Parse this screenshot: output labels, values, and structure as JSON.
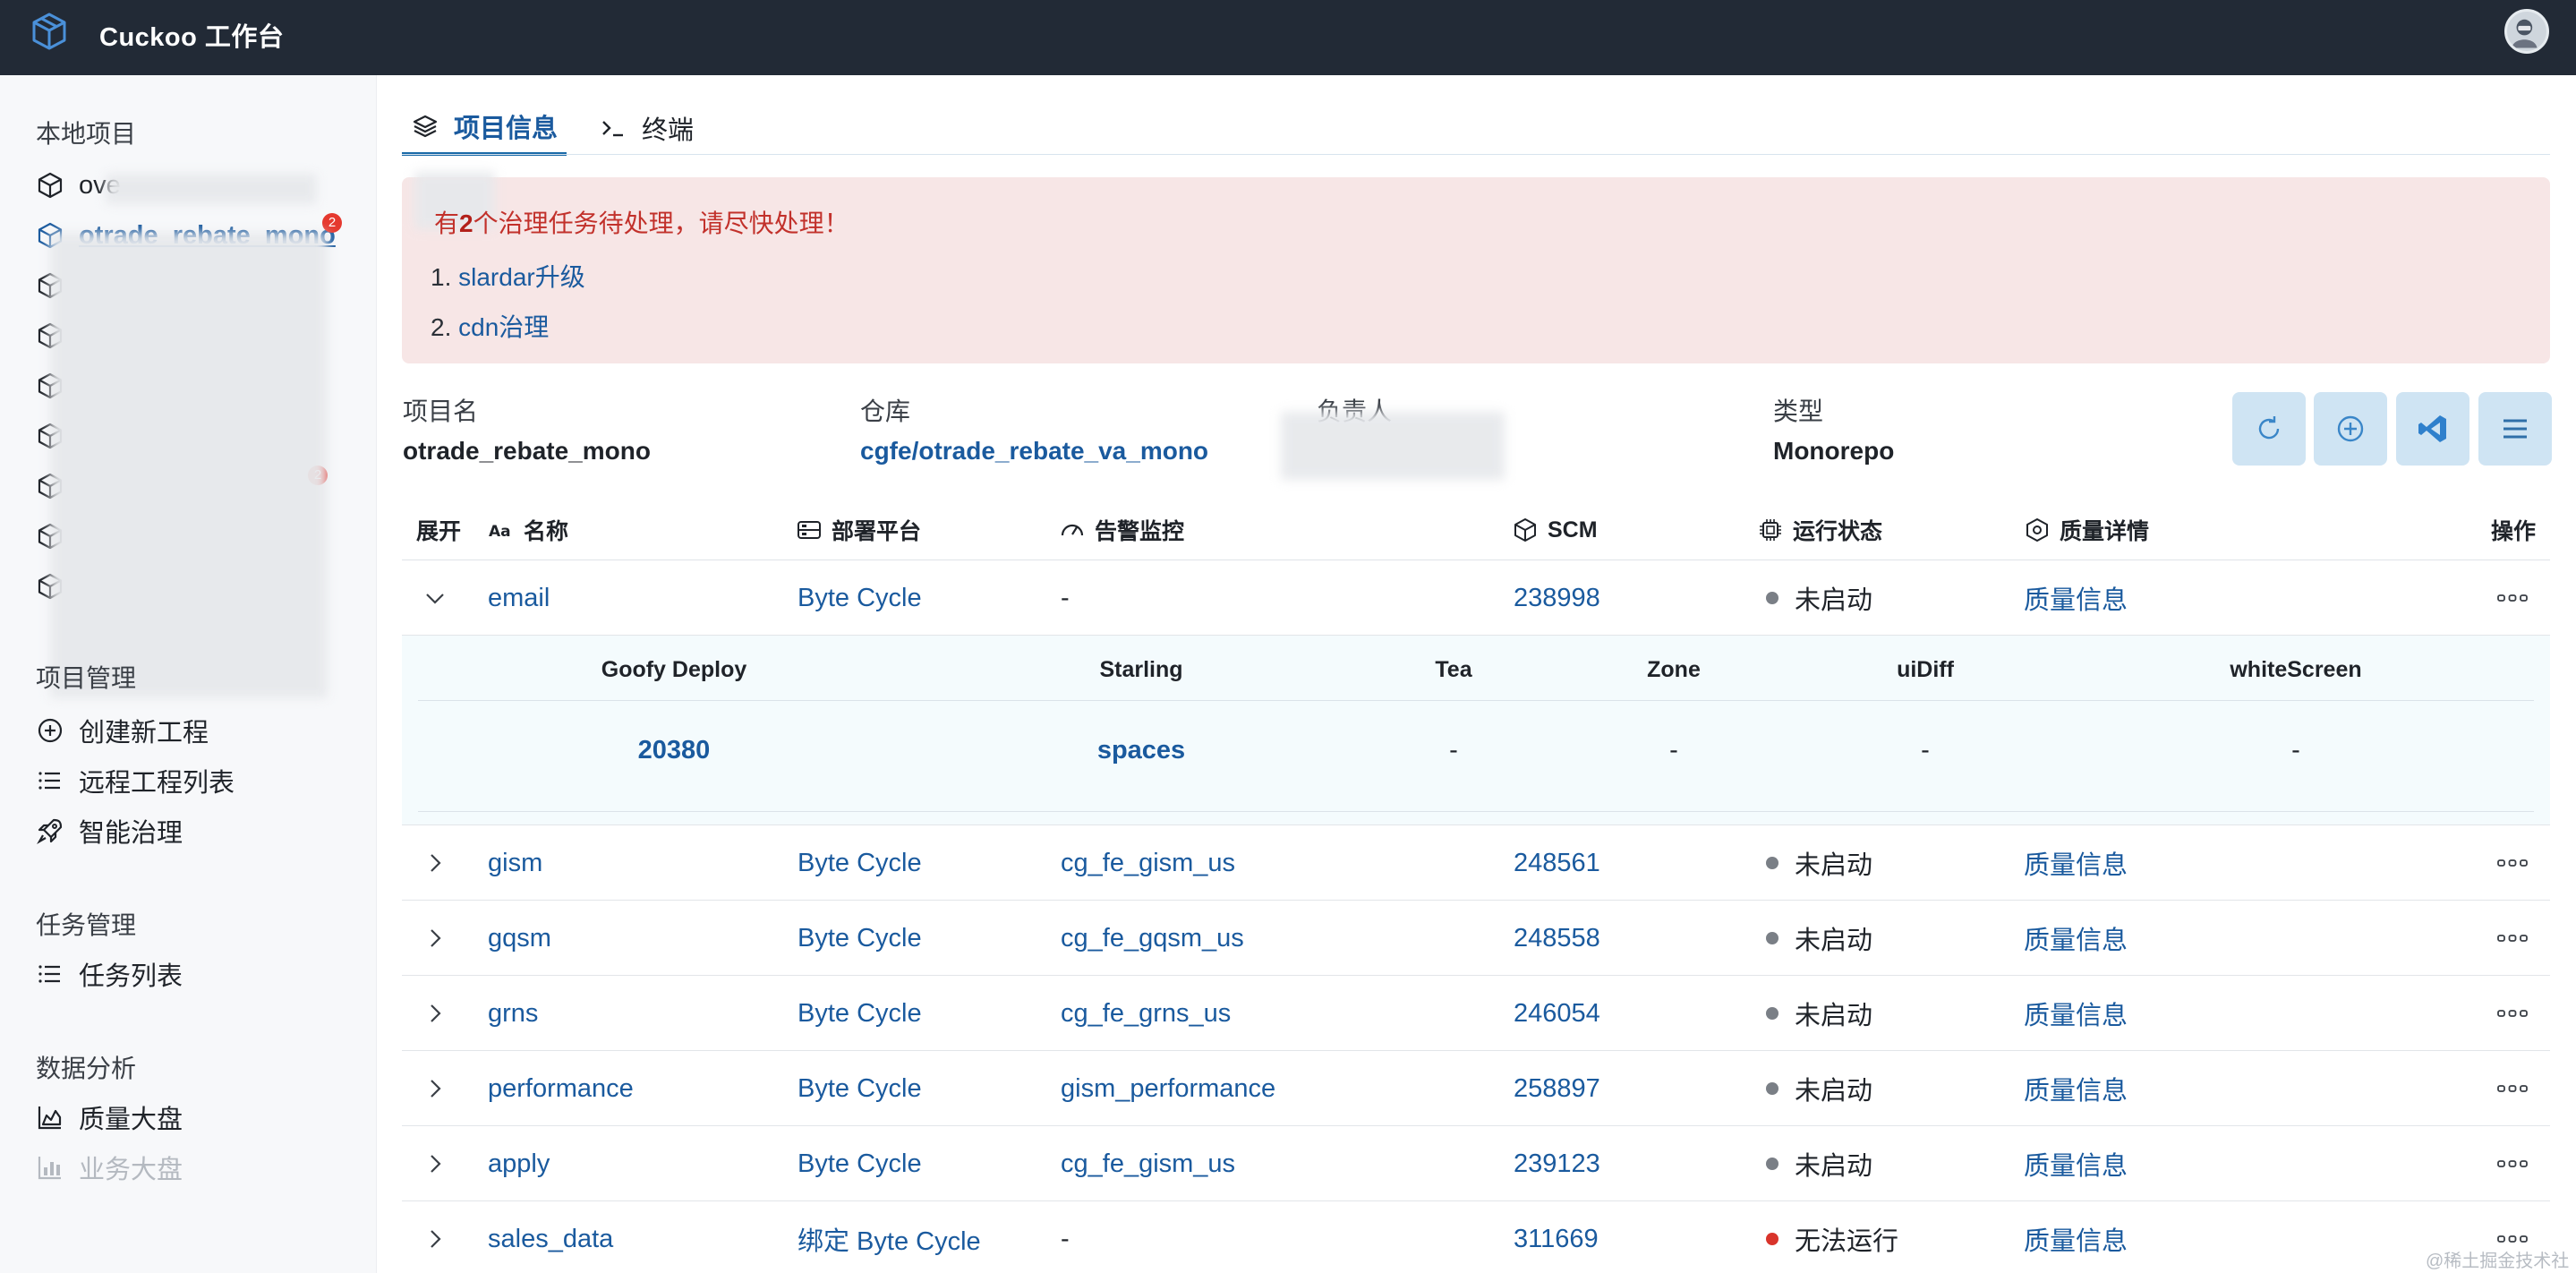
{
  "app": {
    "title": "Cuckoo 工作台"
  },
  "sidebar": {
    "local_projects": {
      "title": "本地项目",
      "items": [
        {
          "label": "ove",
          "badge": ""
        },
        {
          "label": "otrade_rebate_mono",
          "badge": "2"
        },
        {
          "label": "",
          "badge": ""
        },
        {
          "label": "",
          "badge": ""
        },
        {
          "label": "",
          "badge": ""
        },
        {
          "label": "",
          "badge": ""
        },
        {
          "label": "",
          "badge": "2"
        },
        {
          "label": "",
          "badge": ""
        },
        {
          "label": "",
          "badge": ""
        }
      ]
    },
    "project_management": {
      "title": "项目管理",
      "items": [
        {
          "label": "创建新工程",
          "icon": "plus-circle-icon"
        },
        {
          "label": "远程工程列表",
          "icon": "list-icon"
        },
        {
          "label": "智能治理",
          "icon": "rocket-icon"
        }
      ]
    },
    "task_management": {
      "title": "任务管理",
      "items": [
        {
          "label": "任务列表",
          "icon": "list-icon"
        }
      ]
    },
    "data_analysis": {
      "title": "数据分析",
      "items": [
        {
          "label": "质量大盘",
          "icon": "area-chart-icon"
        },
        {
          "label": "业务大盘",
          "icon": "bar-chart-icon"
        }
      ]
    }
  },
  "tabs": [
    {
      "label": "项目信息",
      "icon": "layers-icon",
      "active": true
    },
    {
      "label": "终端",
      "icon": "terminal-icon",
      "active": false
    }
  ],
  "alert": {
    "prefix": "有",
    "count": "2",
    "suffix": "个治理任务待处理，请尽快处理！",
    "items": [
      {
        "num": "1.",
        "label": "slardar升级"
      },
      {
        "num": "2.",
        "label": "cdn治理"
      }
    ]
  },
  "project_info": {
    "name_label": "项目名",
    "name_value": "otrade_rebate_mono",
    "repo_label": "仓库",
    "repo_value": "cgfe/otrade_rebate_va_mono",
    "owner_label": "负责人",
    "type_label": "类型",
    "type_value": "Monorepo"
  },
  "actions": [
    "refresh-icon",
    "plus-circle-icon",
    "vscode-icon",
    "menu-icon"
  ],
  "table": {
    "headers": {
      "expand": "展开",
      "name": "名称",
      "deploy": "部署平台",
      "alarm": "告警监控",
      "scm": "SCM",
      "status": "运行状态",
      "quality": "质量详情",
      "ops": "操作"
    },
    "rows": [
      {
        "name": "email",
        "deploy": "Byte Cycle",
        "alarm": "-",
        "scm": "238998",
        "status": "未启动",
        "status_color": "#7a7f86",
        "quality": "质量信息",
        "expanded": true
      },
      {
        "name": "gism",
        "deploy": "Byte Cycle",
        "alarm": "cg_fe_gism_us",
        "scm": "248561",
        "status": "未启动",
        "status_color": "#7a7f86",
        "quality": "质量信息",
        "expanded": false
      },
      {
        "name": "gqsm",
        "deploy": "Byte Cycle",
        "alarm": "cg_fe_gqsm_us",
        "scm": "248558",
        "status": "未启动",
        "status_color": "#7a7f86",
        "quality": "质量信息",
        "expanded": false
      },
      {
        "name": "grns",
        "deploy": "Byte Cycle",
        "alarm": "cg_fe_grns_us",
        "scm": "246054",
        "status": "未启动",
        "status_color": "#7a7f86",
        "quality": "质量信息",
        "expanded": false
      },
      {
        "name": "performance",
        "deploy": "Byte Cycle",
        "alarm": "gism_performance",
        "scm": "258897",
        "status": "未启动",
        "status_color": "#7a7f86",
        "quality": "质量信息",
        "expanded": false
      },
      {
        "name": "apply",
        "deploy": "Byte Cycle",
        "alarm": "cg_fe_gism_us",
        "scm": "239123",
        "status": "未启动",
        "status_color": "#7a7f86",
        "quality": "质量信息",
        "expanded": false
      },
      {
        "name": "sales_data",
        "deploy": "绑定 Byte Cycle",
        "alarm": "-",
        "scm": "311669",
        "status": "无法运行",
        "status_color": "#d9342b",
        "quality": "质量信息",
        "expanded": false
      }
    ],
    "expanded_detail": {
      "headers": [
        "Goofy Deploy",
        "Starling",
        "Tea",
        "Zone",
        "uiDiff",
        "whiteScreen"
      ],
      "values": [
        "20380",
        "spaces",
        "-",
        "-",
        "-",
        "-"
      ]
    }
  },
  "watermark": "@稀土掘金技术社区",
  "colors": {
    "topbar": "#222a36",
    "link": "#1a5a9e",
    "alert_bg": "#f7e6e6",
    "alert_text": "#c2312b",
    "action_btn_bg": "#cfe4f3"
  }
}
